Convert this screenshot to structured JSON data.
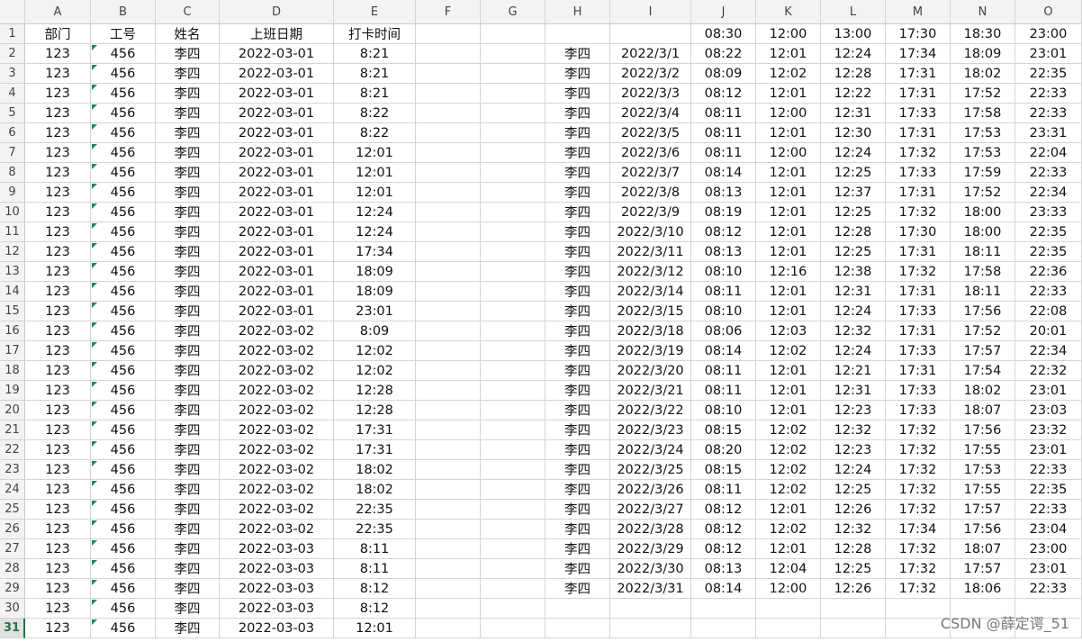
{
  "columns": [
    "A",
    "B",
    "C",
    "D",
    "E",
    "F",
    "G",
    "H",
    "I",
    "J",
    "K",
    "L",
    "M",
    "N",
    "O"
  ],
  "row_numbers": [
    "1",
    "2",
    "3",
    "4",
    "5",
    "6",
    "7",
    "8",
    "9",
    "10",
    "11",
    "12",
    "13",
    "14",
    "15",
    "16",
    "17",
    "18",
    "19",
    "20",
    "21",
    "22",
    "23",
    "24",
    "25",
    "26",
    "27",
    "28",
    "29",
    "30",
    "31"
  ],
  "active_row": "31",
  "left_header": [
    "部门",
    "工号",
    "姓名",
    "上班日期",
    "打卡时间"
  ],
  "left_rows": [
    [
      "123",
      "456",
      "李四",
      "2022-03-01",
      "8:21"
    ],
    [
      "123",
      "456",
      "李四",
      "2022-03-01",
      "8:21"
    ],
    [
      "123",
      "456",
      "李四",
      "2022-03-01",
      "8:21"
    ],
    [
      "123",
      "456",
      "李四",
      "2022-03-01",
      "8:22"
    ],
    [
      "123",
      "456",
      "李四",
      "2022-03-01",
      "8:22"
    ],
    [
      "123",
      "456",
      "李四",
      "2022-03-01",
      "12:01"
    ],
    [
      "123",
      "456",
      "李四",
      "2022-03-01",
      "12:01"
    ],
    [
      "123",
      "456",
      "李四",
      "2022-03-01",
      "12:01"
    ],
    [
      "123",
      "456",
      "李四",
      "2022-03-01",
      "12:24"
    ],
    [
      "123",
      "456",
      "李四",
      "2022-03-01",
      "12:24"
    ],
    [
      "123",
      "456",
      "李四",
      "2022-03-01",
      "17:34"
    ],
    [
      "123",
      "456",
      "李四",
      "2022-03-01",
      "18:09"
    ],
    [
      "123",
      "456",
      "李四",
      "2022-03-01",
      "18:09"
    ],
    [
      "123",
      "456",
      "李四",
      "2022-03-01",
      "23:01"
    ],
    [
      "123",
      "456",
      "李四",
      "2022-03-02",
      "8:09"
    ],
    [
      "123",
      "456",
      "李四",
      "2022-03-02",
      "12:02"
    ],
    [
      "123",
      "456",
      "李四",
      "2022-03-02",
      "12:02"
    ],
    [
      "123",
      "456",
      "李四",
      "2022-03-02",
      "12:28"
    ],
    [
      "123",
      "456",
      "李四",
      "2022-03-02",
      "12:28"
    ],
    [
      "123",
      "456",
      "李四",
      "2022-03-02",
      "17:31"
    ],
    [
      "123",
      "456",
      "李四",
      "2022-03-02",
      "17:31"
    ],
    [
      "123",
      "456",
      "李四",
      "2022-03-02",
      "18:02"
    ],
    [
      "123",
      "456",
      "李四",
      "2022-03-02",
      "18:02"
    ],
    [
      "123",
      "456",
      "李四",
      "2022-03-02",
      "22:35"
    ],
    [
      "123",
      "456",
      "李四",
      "2022-03-02",
      "22:35"
    ],
    [
      "123",
      "456",
      "李四",
      "2022-03-03",
      "8:11"
    ],
    [
      "123",
      "456",
      "李四",
      "2022-03-03",
      "8:11"
    ],
    [
      "123",
      "456",
      "李四",
      "2022-03-03",
      "8:12"
    ],
    [
      "123",
      "456",
      "李四",
      "2022-03-03",
      "8:12"
    ],
    [
      "123",
      "456",
      "李四",
      "2022-03-03",
      "12:01"
    ]
  ],
  "right_header": [
    "",
    "",
    "08:30",
    "12:00",
    "13:00",
    "17:30",
    "18:30",
    "23:00"
  ],
  "right_rows": [
    [
      "李四",
      "2022/3/1",
      "08:22",
      "12:01",
      "12:24",
      "17:34",
      "18:09",
      "23:01"
    ],
    [
      "李四",
      "2022/3/2",
      "08:09",
      "12:02",
      "12:28",
      "17:31",
      "18:02",
      "22:35"
    ],
    [
      "李四",
      "2022/3/3",
      "08:12",
      "12:01",
      "12:22",
      "17:31",
      "17:52",
      "22:33"
    ],
    [
      "李四",
      "2022/3/4",
      "08:11",
      "12:00",
      "12:31",
      "17:33",
      "17:58",
      "22:33"
    ],
    [
      "李四",
      "2022/3/5",
      "08:11",
      "12:01",
      "12:30",
      "17:31",
      "17:53",
      "23:31"
    ],
    [
      "李四",
      "2022/3/6",
      "08:11",
      "12:00",
      "12:24",
      "17:32",
      "17:53",
      "22:04"
    ],
    [
      "李四",
      "2022/3/7",
      "08:14",
      "12:01",
      "12:25",
      "17:33",
      "17:59",
      "22:33"
    ],
    [
      "李四",
      "2022/3/8",
      "08:13",
      "12:01",
      "12:37",
      "17:31",
      "17:52",
      "22:34"
    ],
    [
      "李四",
      "2022/3/9",
      "08:19",
      "12:01",
      "12:25",
      "17:32",
      "18:00",
      "23:33"
    ],
    [
      "李四",
      "2022/3/10",
      "08:12",
      "12:01",
      "12:28",
      "17:30",
      "18:00",
      "22:35"
    ],
    [
      "李四",
      "2022/3/11",
      "08:13",
      "12:01",
      "12:25",
      "17:31",
      "18:11",
      "22:35"
    ],
    [
      "李四",
      "2022/3/12",
      "08:10",
      "12:16",
      "12:38",
      "17:32",
      "17:58",
      "22:36"
    ],
    [
      "李四",
      "2022/3/14",
      "08:11",
      "12:01",
      "12:31",
      "17:31",
      "18:11",
      "22:33"
    ],
    [
      "李四",
      "2022/3/15",
      "08:10",
      "12:01",
      "12:24",
      "17:33",
      "17:56",
      "22:08"
    ],
    [
      "李四",
      "2022/3/18",
      "08:06",
      "12:03",
      "12:32",
      "17:31",
      "17:52",
      "20:01"
    ],
    [
      "李四",
      "2022/3/19",
      "08:14",
      "12:02",
      "12:24",
      "17:33",
      "17:57",
      "22:34"
    ],
    [
      "李四",
      "2022/3/20",
      "08:11",
      "12:01",
      "12:21",
      "17:31",
      "17:54",
      "22:32"
    ],
    [
      "李四",
      "2022/3/21",
      "08:11",
      "12:01",
      "12:31",
      "17:33",
      "18:02",
      "23:01"
    ],
    [
      "李四",
      "2022/3/22",
      "08:10",
      "12:01",
      "12:23",
      "17:33",
      "18:07",
      "23:03"
    ],
    [
      "李四",
      "2022/3/23",
      "08:15",
      "12:02",
      "12:32",
      "17:32",
      "17:56",
      "23:32"
    ],
    [
      "李四",
      "2022/3/24",
      "08:20",
      "12:02",
      "12:23",
      "17:32",
      "17:55",
      "23:01"
    ],
    [
      "李四",
      "2022/3/25",
      "08:15",
      "12:02",
      "12:24",
      "17:32",
      "17:53",
      "22:33"
    ],
    [
      "李四",
      "2022/3/26",
      "08:11",
      "12:02",
      "12:25",
      "17:32",
      "17:55",
      "22:35"
    ],
    [
      "李四",
      "2022/3/27",
      "08:12",
      "12:01",
      "12:26",
      "17:32",
      "17:57",
      "22:33"
    ],
    [
      "李四",
      "2022/3/28",
      "08:12",
      "12:02",
      "12:32",
      "17:34",
      "17:56",
      "23:04"
    ],
    [
      "李四",
      "2022/3/29",
      "08:12",
      "12:01",
      "12:28",
      "17:32",
      "18:07",
      "23:00"
    ],
    [
      "李四",
      "2022/3/30",
      "08:13",
      "12:04",
      "12:25",
      "17:32",
      "17:57",
      "23:01"
    ],
    [
      "李四",
      "2022/3/31",
      "08:14",
      "12:00",
      "12:26",
      "17:32",
      "18:06",
      "22:33"
    ]
  ],
  "watermark": "CSDN @薛定谔_51",
  "colors": {
    "text_indicator": "#1d8a4b",
    "active": "#217346",
    "grid": "#d4d4d4",
    "header_bg": "#f3f3f3"
  }
}
